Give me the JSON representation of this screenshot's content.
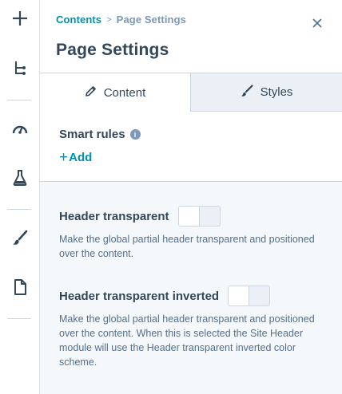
{
  "rail": {
    "items": [
      {
        "icon": "plus-icon"
      },
      {
        "icon": "tree-icon"
      },
      {
        "icon": "gauge-icon"
      },
      {
        "icon": "flask-icon"
      },
      {
        "icon": "brush-icon"
      },
      {
        "icon": "page-icon"
      }
    ]
  },
  "breadcrumb": {
    "parent": "Contents",
    "separator": ">",
    "current": "Page Settings"
  },
  "panel": {
    "title": "Page Settings",
    "close_icon": "close-icon"
  },
  "tabs": [
    {
      "label": "Content",
      "icon": "pencil-icon",
      "selected": true
    },
    {
      "label": "Styles",
      "icon": "brush-icon",
      "selected": false
    }
  ],
  "smart_rules": {
    "label": "Smart rules",
    "info_icon": "i",
    "add_label": "Add",
    "add_symbol": "+"
  },
  "settings": [
    {
      "label": "Header transparent",
      "description": "Make the global partial header transparent and positioned over the content.",
      "enabled": false
    },
    {
      "label": "Header transparent inverted",
      "description": "Make the global partial header transparent and positioned over the content. When this is selected the Site Header module will use the Header transparent inverted color scheme.",
      "enabled": false
    }
  ],
  "colors": {
    "link": "#0091ae",
    "text": "#33475b",
    "muted": "#7c98b6",
    "border": "#cbd6e2",
    "inactive_tab": "#eaf0f6"
  }
}
